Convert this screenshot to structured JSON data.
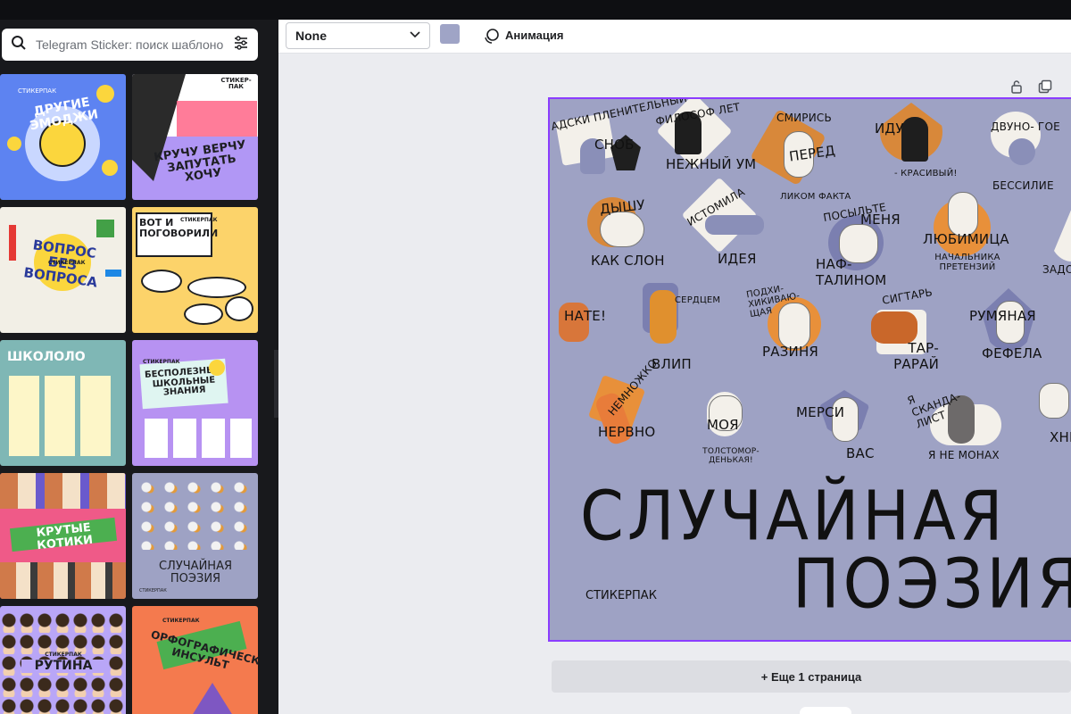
{
  "search": {
    "placeholder": "Telegram Sticker: поиск шаблоно",
    "subtitle": ""
  },
  "toolbar": {
    "font_select": "None",
    "swatch_color": "#9fa4c6",
    "animation_label": "Анимация"
  },
  "templates": [
    {
      "caption": "ДРУГИЕ ЭМОДЖИ",
      "sub": "СТИКЕРПАК",
      "bg": "#5d83f1"
    },
    {
      "caption": "КРУЧУ ВЕРЧУ ЗАПУТАТЬ ХОЧУ",
      "sub": "СТИКЕР-ПАК",
      "bg": "#b197f5"
    },
    {
      "caption": "ВОПРОС БЕЗ ВОПРОСА",
      "sub": "СТИКЕРПАК",
      "bg": "#f2efe6"
    },
    {
      "caption": "ВОТ И ПОГОВОРИЛИ",
      "sub": "СТИКЕРПАК",
      "bg": "#fcd36a"
    },
    {
      "caption": "ШКОЛОЛО",
      "sub": "",
      "bg": "#7fb7b5"
    },
    {
      "caption": "БЕСПОЛЕЗНЫЕ ШКОЛЬНЫЕ ЗНАНИЯ",
      "sub": "СТИКЕРПАК",
      "bg": "#b792f2"
    },
    {
      "caption": "КРУТЫЕ КОТИКИ",
      "sub": "",
      "bg": "#ef5a88"
    },
    {
      "caption": "СЛУЧАЙНАЯ ПОЭЗИЯ",
      "sub": "СТИКЕРПАК",
      "bg": "#9ea2c4"
    },
    {
      "caption": "РУТИНА",
      "sub": "СТИКЕРПАК",
      "bg": "#b9a6f7"
    },
    {
      "caption": "ОРФОГРАФИЧЕСКИЙ ИНСУЛЬТ",
      "sub": "СТИКЕРПАК",
      "bg": "#f47a4e"
    }
  ],
  "design": {
    "title_line1": "СЛУЧАЙНАЯ",
    "title_line2": "ПОЭЗИЯ",
    "pack_label": "СТИКЕРПАК",
    "stickers": [
      "АДСКИ ПЛЕНИТЕЛЬНЫЙ",
      "СНОБ",
      "ФИЛОСОФ ЛЕТ",
      "НЕЖНЫЙ УМ",
      "СМИРИСЬ",
      "ПЕРЕД",
      "ЛИКОМ ФАКТА",
      "ИДУ",
      "- КРАСИВЫЙ!",
      "ДВУНО- ГОЕ",
      "БЕССИЛИЕ",
      "ДЫШУ",
      "КАК СЛОН",
      "ИСТОМИЛА",
      "ИДЕЯ",
      "ПОСЫЛЬТЕ",
      "МЕНЯ",
      "НАФ- ТАЛИНОМ",
      "ЛЮБИМИЦА",
      "НАЧАЛЬНИКА ПРЕТЕНЗИЙ",
      "ЗАДОМ",
      "НАТЕ!",
      "СЕРДЦЕМ",
      "ВЛИП",
      "ПОДХИ- ХИКИВАЮ- ЩАЯ",
      "РАЗИНЯ",
      "СИГТАРЬ",
      "ТАР- РАРАЙ",
      "РУМЯНАЯ",
      "ФЕФЕЛА",
      "НЕМНОЖКО",
      "НЕРВНО",
      "МОЯ",
      "ТОЛСТОМОР- ДЕНЬКАЯ!",
      "МЕРСИ",
      "ВАС",
      "Я СКАНДА- ЛИСТ",
      "Я НЕ МОНАХ",
      "ХНЫ"
    ]
  },
  "more_pages": "+ Еще 1 страница"
}
